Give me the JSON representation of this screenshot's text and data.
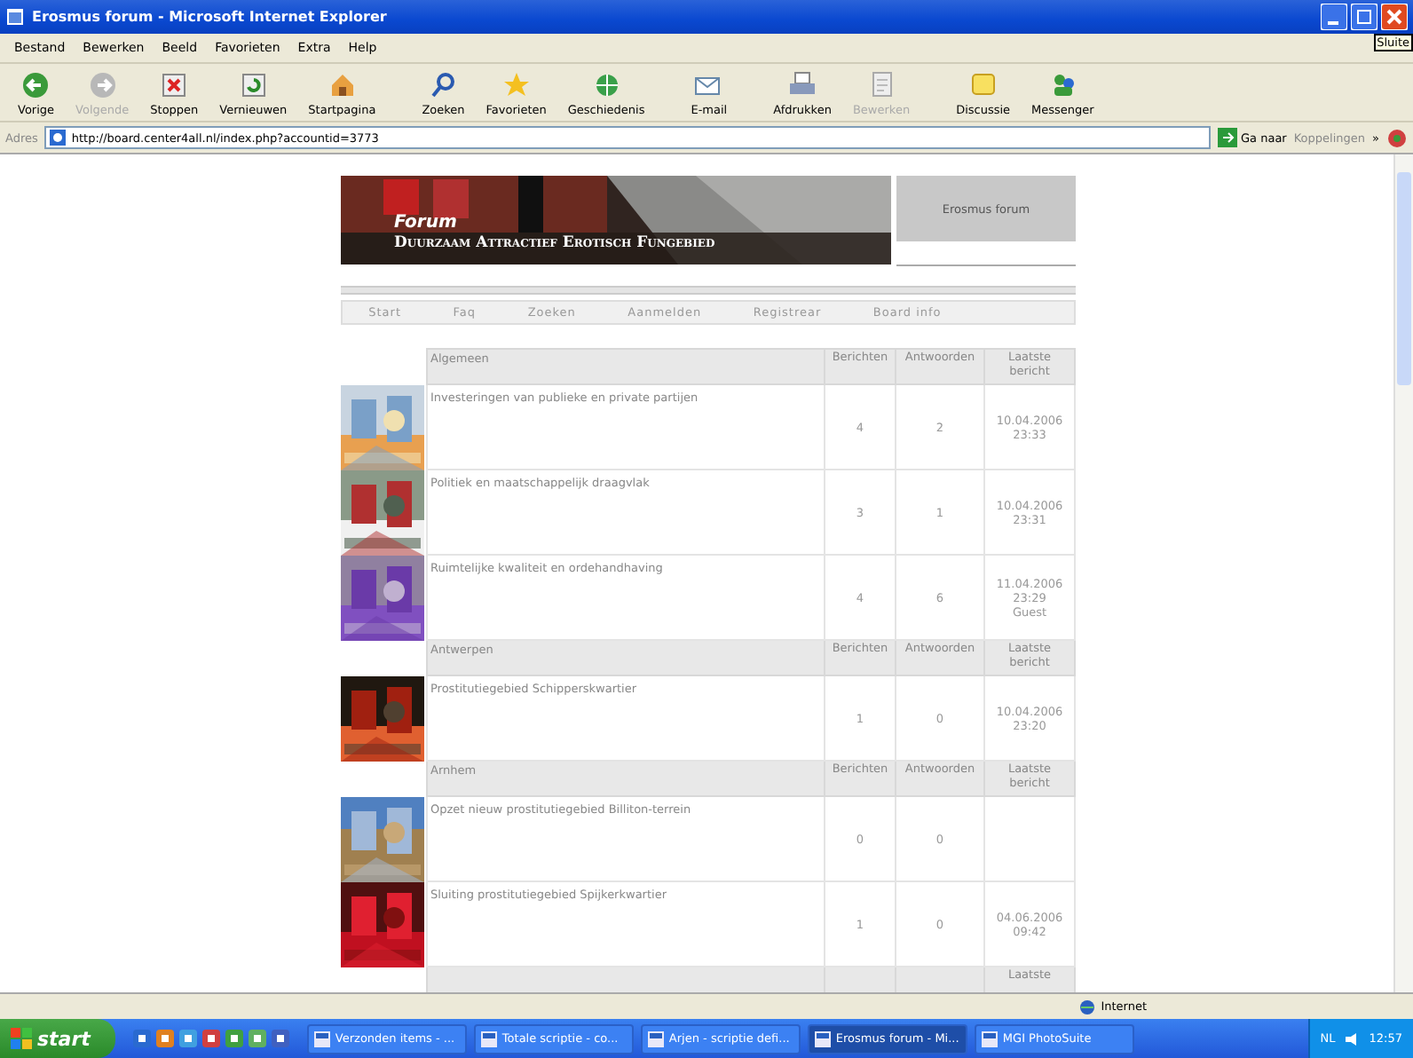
{
  "window": {
    "title": "Erosmus forum - Microsoft Internet Explorer",
    "tooltip": "Sluite"
  },
  "menu": [
    "Bestand",
    "Bewerken",
    "Beeld",
    "Favorieten",
    "Extra",
    "Help"
  ],
  "toolbar": [
    {
      "label": "Vorige",
      "kind": "back",
      "disabled": false
    },
    {
      "label": "Volgende",
      "kind": "forward",
      "disabled": true
    },
    {
      "label": "Stoppen",
      "kind": "stop",
      "disabled": false
    },
    {
      "label": "Vernieuwen",
      "kind": "refresh",
      "disabled": false
    },
    {
      "label": "Startpagina",
      "kind": "home",
      "disabled": false
    },
    {
      "label": "Zoeken",
      "kind": "search",
      "disabled": false
    },
    {
      "label": "Favorieten",
      "kind": "star",
      "disabled": false
    },
    {
      "label": "Geschiedenis",
      "kind": "globe",
      "disabled": false
    },
    {
      "label": "E-mail",
      "kind": "mail",
      "disabled": false
    },
    {
      "label": "Afdrukken",
      "kind": "print",
      "disabled": false
    },
    {
      "label": "Bewerken",
      "kind": "edit",
      "disabled": true
    },
    {
      "label": "Discussie",
      "kind": "note",
      "disabled": false
    },
    {
      "label": "Messenger",
      "kind": "people",
      "disabled": false
    }
  ],
  "address": {
    "label": "Adres",
    "value": "http://board.center4all.nl/index.php?accountid=3773",
    "go": "Ga naar",
    "links": "Koppelingen",
    "more": "»"
  },
  "page": {
    "banner_title": "Forum",
    "banner_subtitle": "Duurzaam Attractief Erotisch Fungebied",
    "site_box": "Erosmus forum",
    "nav": [
      "Start",
      "Faq",
      "Zoeken",
      "Aanmelden",
      "Registrear",
      "Board info"
    ],
    "sections": [
      {
        "name": "Algemeen",
        "columns": [
          "Berichten",
          "Antwoorden",
          "Laatste bericht"
        ],
        "forums": [
          {
            "title": "Investeringen van publieke en private partijen",
            "posts": "4",
            "replies": "2",
            "last": [
              "10.04.2006",
              "23:33"
            ]
          },
          {
            "title": "Politiek en maatschappelijk draagvlak",
            "posts": "3",
            "replies": "1",
            "last": [
              "10.04.2006",
              "23:31"
            ]
          },
          {
            "title": "Ruimtelijke kwaliteit en ordehandhaving",
            "posts": "4",
            "replies": "6",
            "last": [
              "11.04.2006",
              "23:29",
              "Guest"
            ]
          }
        ]
      },
      {
        "name": "Antwerpen",
        "columns": [
          "Berichten",
          "Antwoorden",
          "Laatste bericht"
        ],
        "forums": [
          {
            "title": "Prostitutiegebied Schipperskwartier",
            "posts": "1",
            "replies": "0",
            "last": [
              "10.04.2006",
              "23:20"
            ]
          }
        ]
      },
      {
        "name": "Arnhem",
        "columns": [
          "Berichten",
          "Antwoorden",
          "Laatste bericht"
        ],
        "forums": [
          {
            "title": "Opzet nieuw prostitutiegebied Billiton-terrein",
            "posts": "0",
            "replies": "0"
          },
          {
            "title": "Sluiting prostitutiegebied Spijkerkwartier",
            "posts": "1",
            "replies": "0",
            "last": [
              "04.06.2006",
              "09:42"
            ]
          }
        ]
      },
      {
        "columns": [
          "Laatste"
        ]
      }
    ]
  },
  "status_bar": {
    "zone": "Internet"
  },
  "taskbar": {
    "start": "start",
    "tasks": [
      {
        "label": "Verzonden items - ...",
        "selected": false
      },
      {
        "label": "Totale scriptie - co...",
        "selected": false
      },
      {
        "label": "Arjen - scriptie defi...",
        "selected": false
      },
      {
        "label": "Erosmus forum - Mi...",
        "selected": true
      },
      {
        "label": "MGI PhotoSuite",
        "selected": false
      }
    ],
    "language": "NL",
    "clock": "12:57"
  }
}
